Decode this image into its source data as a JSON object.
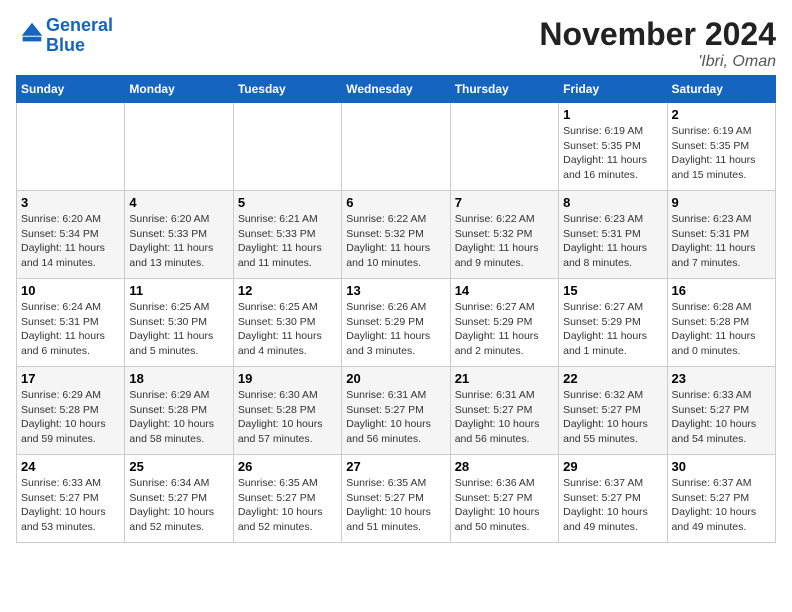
{
  "header": {
    "logo_line1": "General",
    "logo_line2": "Blue",
    "month": "November 2024",
    "location": "'Ibri, Oman"
  },
  "days_of_week": [
    "Sunday",
    "Monday",
    "Tuesday",
    "Wednesday",
    "Thursday",
    "Friday",
    "Saturday"
  ],
  "weeks": [
    [
      {
        "day": "",
        "info": ""
      },
      {
        "day": "",
        "info": ""
      },
      {
        "day": "",
        "info": ""
      },
      {
        "day": "",
        "info": ""
      },
      {
        "day": "",
        "info": ""
      },
      {
        "day": "1",
        "info": "Sunrise: 6:19 AM\nSunset: 5:35 PM\nDaylight: 11 hours and 16 minutes."
      },
      {
        "day": "2",
        "info": "Sunrise: 6:19 AM\nSunset: 5:35 PM\nDaylight: 11 hours and 15 minutes."
      }
    ],
    [
      {
        "day": "3",
        "info": "Sunrise: 6:20 AM\nSunset: 5:34 PM\nDaylight: 11 hours and 14 minutes."
      },
      {
        "day": "4",
        "info": "Sunrise: 6:20 AM\nSunset: 5:33 PM\nDaylight: 11 hours and 13 minutes."
      },
      {
        "day": "5",
        "info": "Sunrise: 6:21 AM\nSunset: 5:33 PM\nDaylight: 11 hours and 11 minutes."
      },
      {
        "day": "6",
        "info": "Sunrise: 6:22 AM\nSunset: 5:32 PM\nDaylight: 11 hours and 10 minutes."
      },
      {
        "day": "7",
        "info": "Sunrise: 6:22 AM\nSunset: 5:32 PM\nDaylight: 11 hours and 9 minutes."
      },
      {
        "day": "8",
        "info": "Sunrise: 6:23 AM\nSunset: 5:31 PM\nDaylight: 11 hours and 8 minutes."
      },
      {
        "day": "9",
        "info": "Sunrise: 6:23 AM\nSunset: 5:31 PM\nDaylight: 11 hours and 7 minutes."
      }
    ],
    [
      {
        "day": "10",
        "info": "Sunrise: 6:24 AM\nSunset: 5:31 PM\nDaylight: 11 hours and 6 minutes."
      },
      {
        "day": "11",
        "info": "Sunrise: 6:25 AM\nSunset: 5:30 PM\nDaylight: 11 hours and 5 minutes."
      },
      {
        "day": "12",
        "info": "Sunrise: 6:25 AM\nSunset: 5:30 PM\nDaylight: 11 hours and 4 minutes."
      },
      {
        "day": "13",
        "info": "Sunrise: 6:26 AM\nSunset: 5:29 PM\nDaylight: 11 hours and 3 minutes."
      },
      {
        "day": "14",
        "info": "Sunrise: 6:27 AM\nSunset: 5:29 PM\nDaylight: 11 hours and 2 minutes."
      },
      {
        "day": "15",
        "info": "Sunrise: 6:27 AM\nSunset: 5:29 PM\nDaylight: 11 hours and 1 minute."
      },
      {
        "day": "16",
        "info": "Sunrise: 6:28 AM\nSunset: 5:28 PM\nDaylight: 11 hours and 0 minutes."
      }
    ],
    [
      {
        "day": "17",
        "info": "Sunrise: 6:29 AM\nSunset: 5:28 PM\nDaylight: 10 hours and 59 minutes."
      },
      {
        "day": "18",
        "info": "Sunrise: 6:29 AM\nSunset: 5:28 PM\nDaylight: 10 hours and 58 minutes."
      },
      {
        "day": "19",
        "info": "Sunrise: 6:30 AM\nSunset: 5:28 PM\nDaylight: 10 hours and 57 minutes."
      },
      {
        "day": "20",
        "info": "Sunrise: 6:31 AM\nSunset: 5:27 PM\nDaylight: 10 hours and 56 minutes."
      },
      {
        "day": "21",
        "info": "Sunrise: 6:31 AM\nSunset: 5:27 PM\nDaylight: 10 hours and 56 minutes."
      },
      {
        "day": "22",
        "info": "Sunrise: 6:32 AM\nSunset: 5:27 PM\nDaylight: 10 hours and 55 minutes."
      },
      {
        "day": "23",
        "info": "Sunrise: 6:33 AM\nSunset: 5:27 PM\nDaylight: 10 hours and 54 minutes."
      }
    ],
    [
      {
        "day": "24",
        "info": "Sunrise: 6:33 AM\nSunset: 5:27 PM\nDaylight: 10 hours and 53 minutes."
      },
      {
        "day": "25",
        "info": "Sunrise: 6:34 AM\nSunset: 5:27 PM\nDaylight: 10 hours and 52 minutes."
      },
      {
        "day": "26",
        "info": "Sunrise: 6:35 AM\nSunset: 5:27 PM\nDaylight: 10 hours and 52 minutes."
      },
      {
        "day": "27",
        "info": "Sunrise: 6:35 AM\nSunset: 5:27 PM\nDaylight: 10 hours and 51 minutes."
      },
      {
        "day": "28",
        "info": "Sunrise: 6:36 AM\nSunset: 5:27 PM\nDaylight: 10 hours and 50 minutes."
      },
      {
        "day": "29",
        "info": "Sunrise: 6:37 AM\nSunset: 5:27 PM\nDaylight: 10 hours and 49 minutes."
      },
      {
        "day": "30",
        "info": "Sunrise: 6:37 AM\nSunset: 5:27 PM\nDaylight: 10 hours and 49 minutes."
      }
    ]
  ]
}
